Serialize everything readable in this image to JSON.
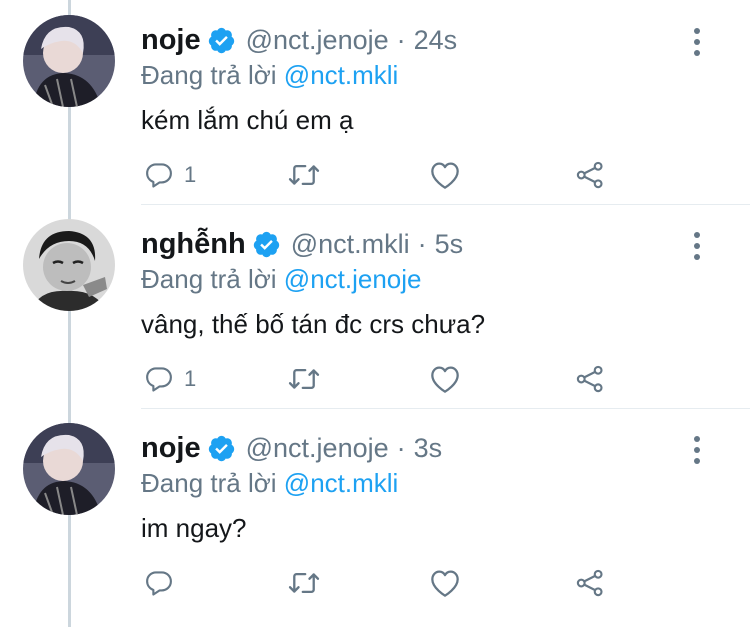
{
  "tweets": [
    {
      "name": "noje",
      "handle": "@nct.jenoje",
      "separator": "·",
      "time": "24s",
      "reply_prefix": "Đang trả lời",
      "reply_to": "@nct.mkli",
      "text": "kém lắm chú em ạ",
      "reply_count": "1"
    },
    {
      "name": "nghễnh",
      "handle": "@nct.mkli",
      "separator": "·",
      "time": "5s",
      "reply_prefix": "Đang trả lời",
      "reply_to": "@nct.jenoje",
      "text": "vâng, thế bố tán đc crs chưa?",
      "reply_count": "1"
    },
    {
      "name": "noje",
      "handle": "@nct.jenoje",
      "separator": "·",
      "time": "3s",
      "reply_prefix": "Đang trả lời",
      "reply_to": "@nct.mkli",
      "text": "im ngay?",
      "reply_count": ""
    }
  ],
  "colors": {
    "verified": "#1da1f2",
    "mention": "#1da1f2",
    "secondary": "#657786",
    "thread_line": "#ccd6dd"
  },
  "icons": [
    "verified-badge-icon",
    "more-options-icon",
    "reply-icon",
    "retweet-icon",
    "like-icon",
    "share-icon"
  ]
}
